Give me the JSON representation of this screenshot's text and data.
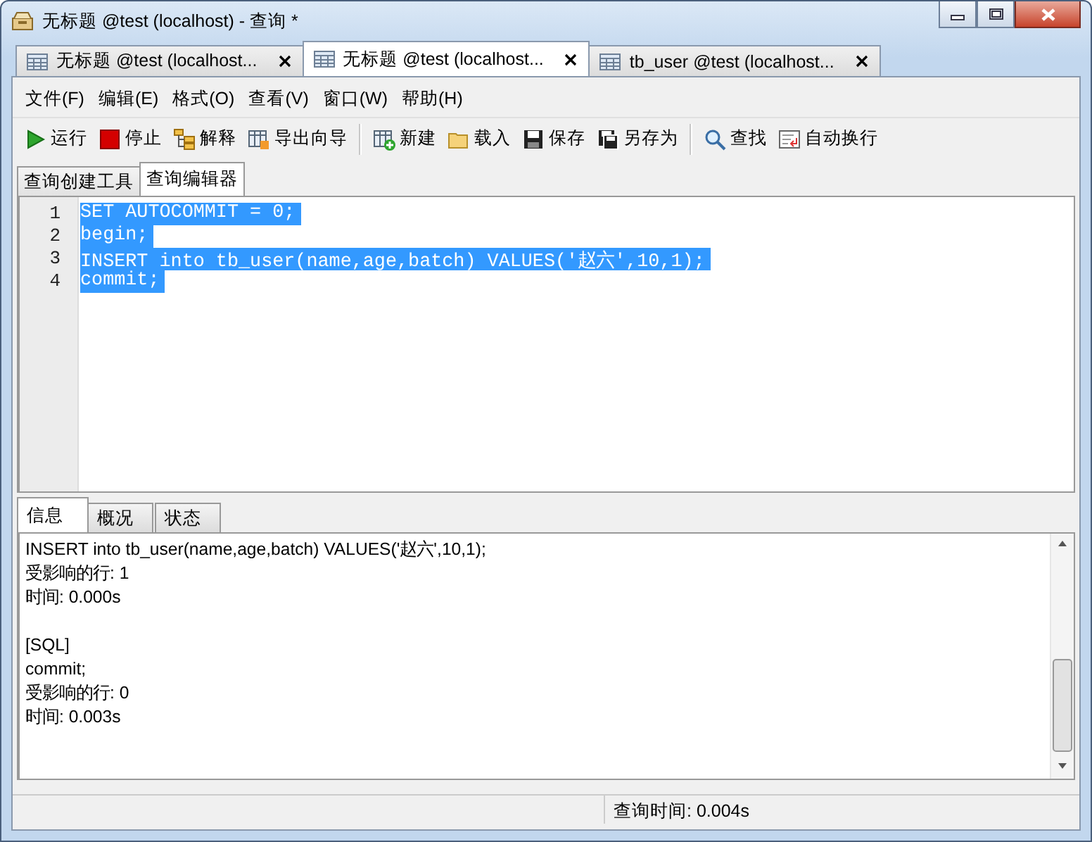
{
  "window": {
    "title": "无标题 @test (localhost) - 查询 *"
  },
  "doc_tabs": [
    {
      "label": "无标题 @test (localhost...",
      "selected": false
    },
    {
      "label": "无标题 @test (localhost...",
      "selected": true
    },
    {
      "label": "tb_user @test (localhost...",
      "selected": false
    }
  ],
  "menu": [
    "文件(F)",
    "编辑(E)",
    "格式(O)",
    "查看(V)",
    "窗口(W)",
    "帮助(H)"
  ],
  "toolbar": [
    [
      "运行",
      "停止",
      "解释",
      "导出向导"
    ],
    [
      "新建",
      "载入",
      "保存",
      "另存为"
    ],
    [
      "查找",
      "自动换行"
    ]
  ],
  "editor_tabs": [
    {
      "label": "查询创建工具",
      "selected": false
    },
    {
      "label": "查询编辑器",
      "selected": true
    }
  ],
  "editor": {
    "lines": [
      {
        "number": "1",
        "text": "SET AUTOCOMMIT = 0;",
        "selected": true
      },
      {
        "number": "2",
        "text": "begin;",
        "selected": true
      },
      {
        "number": "3",
        "text": "INSERT into tb_user(name,age,batch) VALUES('赵六',10,1);",
        "selected": true
      },
      {
        "number": "4",
        "text": "commit;",
        "selected": true
      }
    ]
  },
  "result_tabs": [
    {
      "label": "信息",
      "selected": true
    },
    {
      "label": "概况",
      "selected": false
    },
    {
      "label": "状态",
      "selected": false
    }
  ],
  "messages": [
    [
      "INSERT into tb_user(name,age,batch) VALUES('赵六',10,1);",
      "受影响的行: 1",
      "时间: 0.000s"
    ],
    [
      "[SQL]",
      "commit;",
      "受影响的行: 0",
      "时间: 0.003s"
    ]
  ],
  "status_bar": {
    "query_time": "查询时间: 0.004s"
  }
}
